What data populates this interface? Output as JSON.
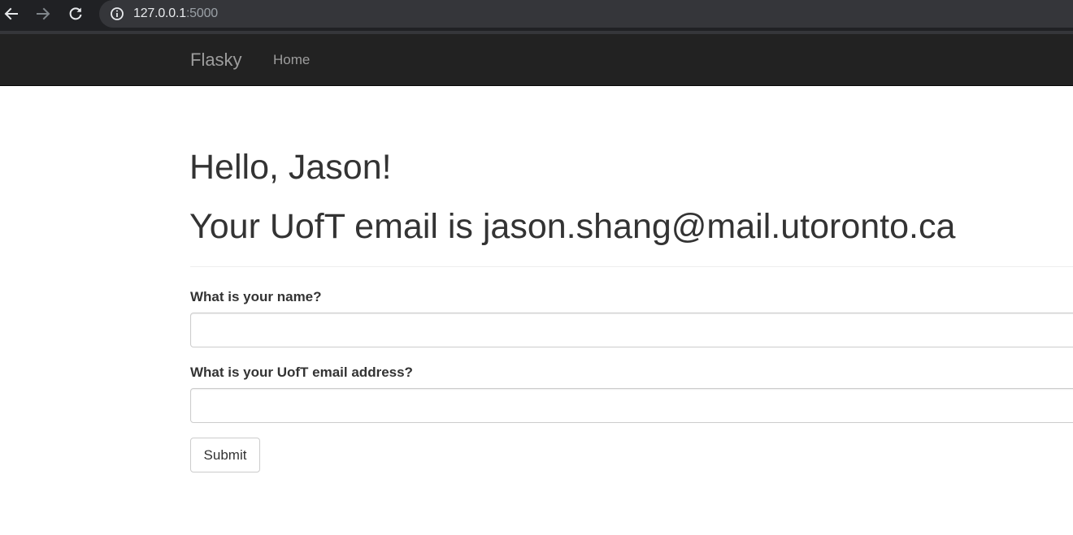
{
  "browser": {
    "url_host": "127.0.0.1",
    "url_port": ":5000",
    "icons": [
      "arrow-left-icon",
      "arrow-right-icon",
      "reload-icon",
      "info-icon"
    ]
  },
  "navbar": {
    "brand": "Flasky",
    "links": [
      {
        "label": "Home"
      }
    ]
  },
  "header": {
    "greeting": "Hello, Jason!",
    "email_line": "Your UofT email is jason.shang@mail.utoronto.ca"
  },
  "form": {
    "name_label": "What is your name?",
    "name_value": "",
    "email_label": "What is your UofT email address?",
    "email_value": "",
    "submit_label": "Submit"
  },
  "colors": {
    "navbar_bg": "#222222",
    "navbar_text": "#9d9d9d",
    "browser_chrome": "#202124",
    "text": "#333333"
  }
}
